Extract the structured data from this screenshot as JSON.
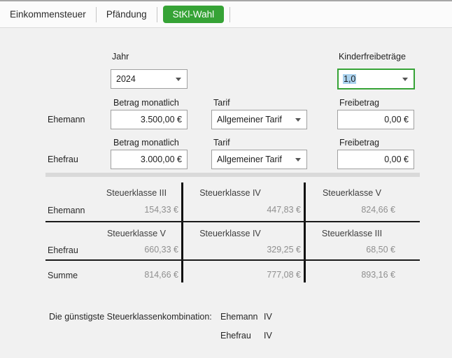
{
  "tabs": [
    {
      "label": "Einkommensteuer",
      "active": false
    },
    {
      "label": "Pfändung",
      "active": false
    },
    {
      "label": "StKl-Wahl",
      "active": true
    }
  ],
  "form": {
    "jahr": {
      "label": "Jahr",
      "value": "2024"
    },
    "kinderfreibetraege": {
      "label": "Kinderfreibeträge",
      "value": "1,0"
    },
    "field_labels": {
      "betrag": "Betrag monatlich",
      "tarif": "Tarif",
      "freibetrag": "Freibetrag"
    },
    "rows": [
      {
        "label": "Ehemann",
        "betrag": "3.500,00 €",
        "tarif": "Allgemeiner Tarif",
        "freibetrag": "0,00 €"
      },
      {
        "label": "Ehefrau",
        "betrag": "3.000,00 €",
        "tarif": "Allgemeiner Tarif",
        "freibetrag": "0,00 €"
      }
    ]
  },
  "results": {
    "ehemann": {
      "label": "Ehemann",
      "headers": [
        "Steuerklasse III",
        "Steuerklasse IV",
        "Steuerklasse V"
      ],
      "values": [
        "154,33 €",
        "447,83 €",
        "824,66 €"
      ]
    },
    "ehefrau": {
      "label": "Ehefrau",
      "headers": [
        "Steuerklasse V",
        "Steuerklasse IV",
        "Steuerklasse III"
      ],
      "values": [
        "660,33 €",
        "329,25 €",
        "68,50 €"
      ]
    },
    "summe": {
      "label": "Summe",
      "values": [
        "814,66 €",
        "777,08 €",
        "893,16 €"
      ]
    }
  },
  "best_combination": {
    "label": "Die günstigste Steuerklassenkombination:",
    "entries": [
      {
        "person": "Ehemann",
        "steuerklasse": "IV"
      },
      {
        "person": "Ehefrau",
        "steuerklasse": "IV"
      }
    ]
  },
  "colors": {
    "accent_green": "#36a336",
    "selection_blue": "#abd2ee"
  }
}
